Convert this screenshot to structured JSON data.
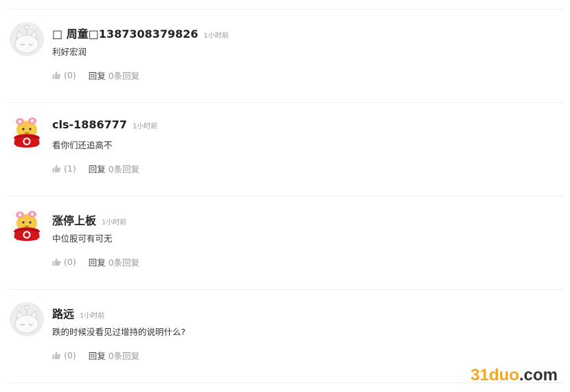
{
  "comments": [
    {
      "user": "□ 周童□1387308379826",
      "time": "1小时前",
      "text": "利好宏润",
      "avatar_icon": "default-cat-avatar",
      "likes": "(0)",
      "reply_label": "回复",
      "reply_count": "0条回复"
    },
    {
      "user": "cls-1886777",
      "time": "1小时前",
      "text": "看你们还追高不",
      "avatar_icon": "red-mascot-avatar",
      "likes": "(1)",
      "reply_label": "回复",
      "reply_count": "0条回复"
    },
    {
      "user": "涨停上板",
      "time": "1小时前",
      "text": "中位股可有可无",
      "avatar_icon": "red-mascot-avatar",
      "likes": "(0)",
      "reply_label": "回复",
      "reply_count": "0条回复"
    },
    {
      "user": "路远",
      "time": "1小时前",
      "text": "跌的时候没看见过增持的说明什么?",
      "avatar_icon": "default-cat-avatar",
      "likes": "(0)",
      "reply_label": "回复",
      "reply_count": "0条回复"
    }
  ],
  "watermark": {
    "accent": "31duo",
    "rest": ".com",
    "accent_color": "#f5a623"
  },
  "icons": {
    "like": "thumbs-up-icon"
  }
}
